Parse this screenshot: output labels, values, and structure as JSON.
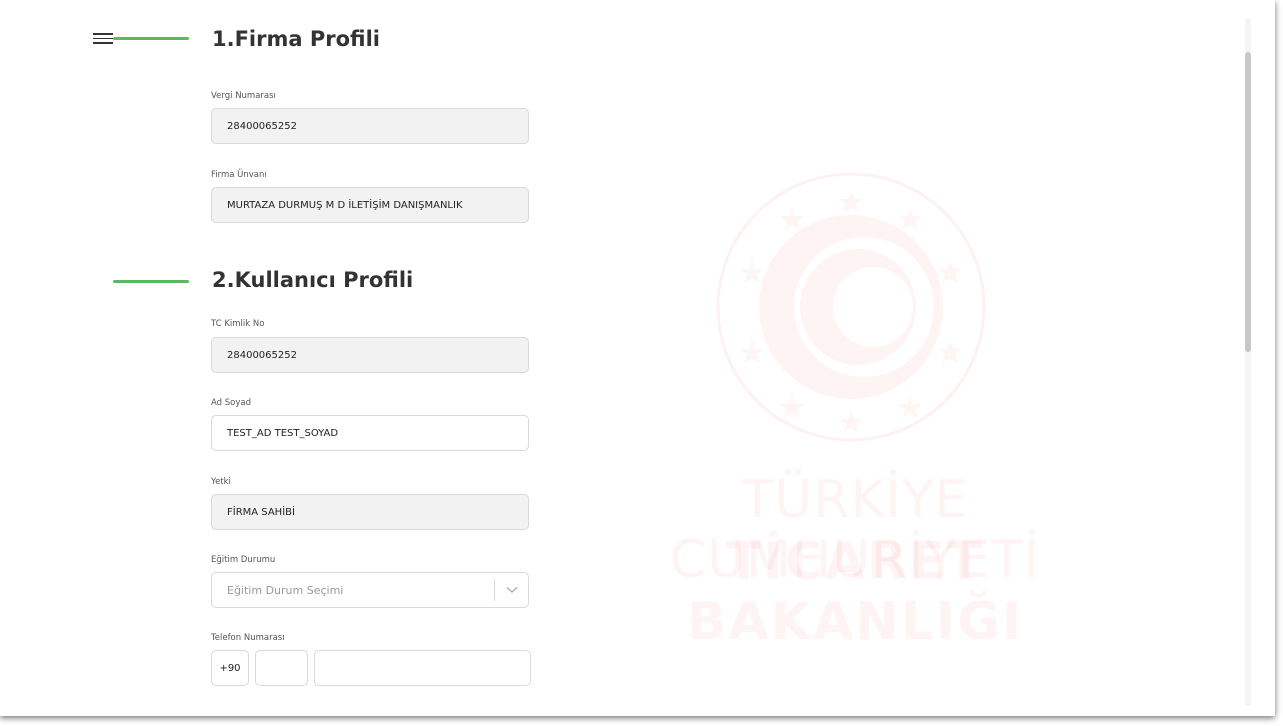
{
  "sections": {
    "firma_title": "1.Firma Profili",
    "kullanici_title": "2.Kullanıcı Profili"
  },
  "firma": {
    "vergi_label": "Vergi Numarası",
    "vergi_value": "28400065252",
    "unvan_label": "Firma Ünvanı",
    "unvan_value": "MURTAZA DURMUŞ M D İLETİŞİM DANIŞMANLIK"
  },
  "kullanici": {
    "tc_label": "TC Kimlik No",
    "tc_value": "28400065252",
    "ad_label": "Ad Soyad",
    "ad_value": "TEST_AD TEST_SOYAD",
    "yetki_label": "Yetki",
    "yetki_value": "FİRMA SAHİBİ",
    "egitim_label": "Eğitim Durumu",
    "egitim_placeholder": "Eğitim Durum Seçimi",
    "telefon_label": "Telefon Numarası",
    "telefon_prefix": "+90",
    "telefon_area": "",
    "telefon_number": ""
  },
  "watermark": {
    "line1": "TÜRKİYE CUMHURİYETİ",
    "line2": "TİCARET BAKANLIĞI"
  },
  "colors": {
    "accent_green": "#5cb85c",
    "watermark_red": "#e74c3c",
    "readonly_bg": "#f2f2f2"
  },
  "icons": {
    "menu": "hamburger-menu-icon",
    "dropdown": "chevron-down-icon",
    "emblem": "ministry-emblem-icon"
  }
}
